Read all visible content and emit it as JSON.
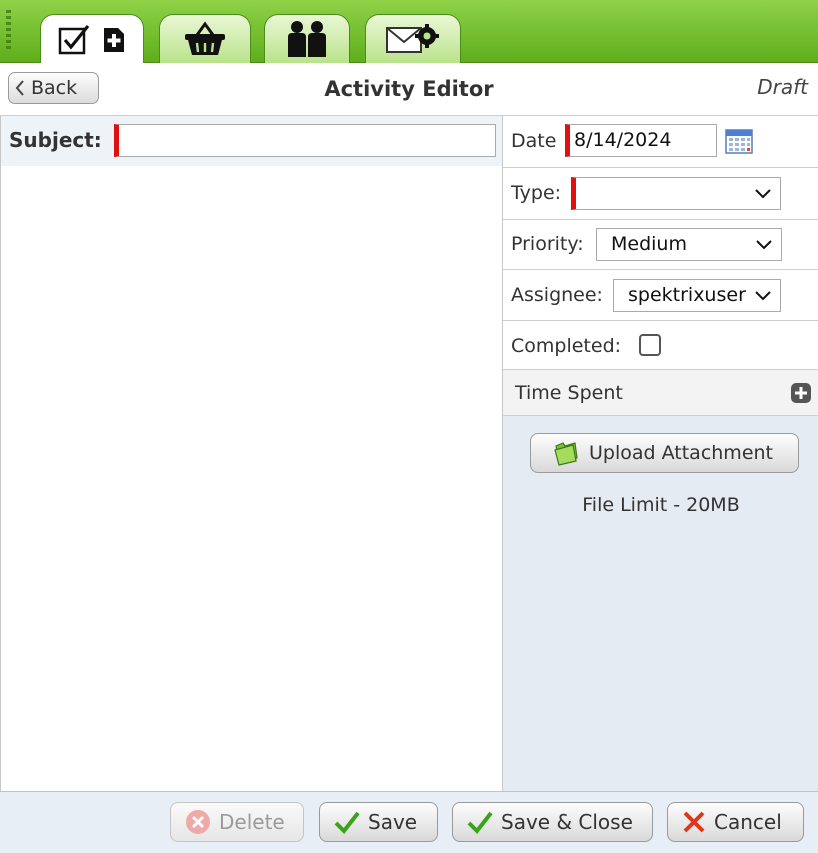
{
  "tabs": [
    {
      "icon": "activity-add-icon",
      "active": true
    },
    {
      "icon": "basket-icon",
      "active": false
    },
    {
      "icon": "customers-icon",
      "active": false
    },
    {
      "icon": "mail-settings-icon",
      "active": false
    }
  ],
  "header": {
    "back_label": "Back",
    "title": "Activity Editor",
    "status": "Draft"
  },
  "subject": {
    "label": "Subject:",
    "value": ""
  },
  "fields": {
    "date_label": "Date",
    "date_value": "8/14/2024",
    "type_label": "Type:",
    "type_value": "",
    "priority_label": "Priority:",
    "priority_value": "Medium",
    "assignee_label": "Assignee:",
    "assignee_value": "spektrixuser",
    "completed_label": "Completed:",
    "completed_checked": false,
    "time_spent_label": "Time Spent"
  },
  "attachments": {
    "upload_label": "Upload Attachment",
    "file_limit": "File Limit - 20MB"
  },
  "footer": {
    "delete_label": "Delete",
    "save_label": "Save",
    "save_close_label": "Save & Close",
    "cancel_label": "Cancel"
  },
  "colors": {
    "tabbar_green": "#6cbb26",
    "required_marker": "#e01010",
    "check_green": "#3aa31a",
    "cancel_red": "#e0361a"
  }
}
